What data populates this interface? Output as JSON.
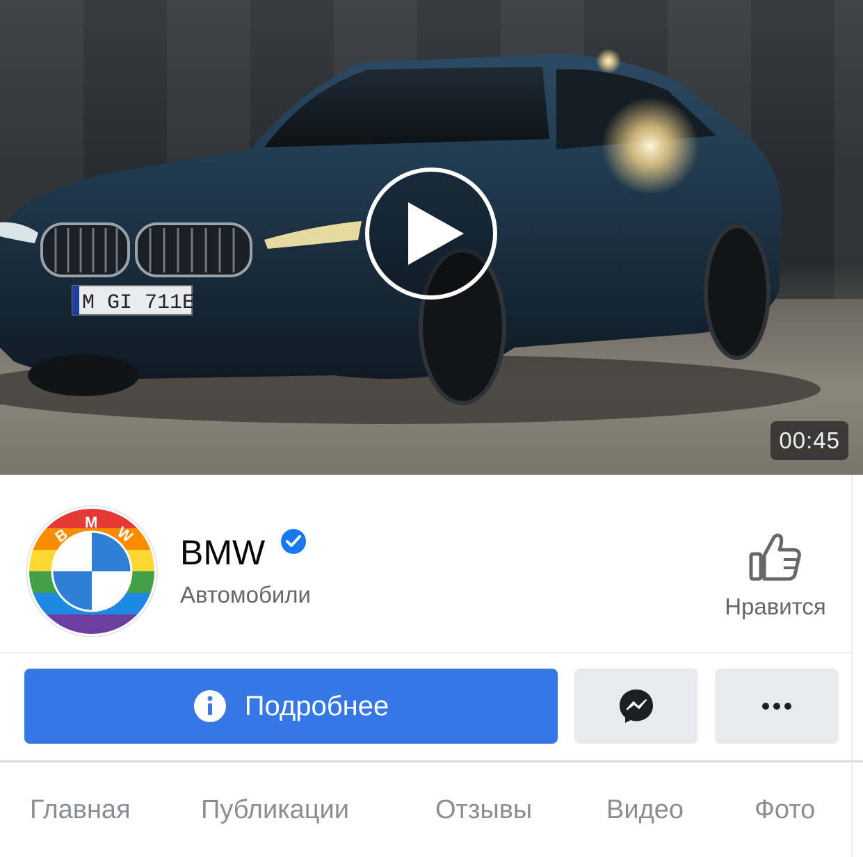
{
  "video": {
    "duration": "00:45",
    "plate": "M GI 711E"
  },
  "page": {
    "name": "BMW",
    "category": "Автомобили",
    "avatar_letters": [
      "B",
      "M",
      "W"
    ]
  },
  "actions": {
    "like_label": "Нравится",
    "more_info_label": "Подробнее"
  },
  "tabs": [
    {
      "label": "Главная"
    },
    {
      "label": "Публикации"
    },
    {
      "label": "Отзывы"
    },
    {
      "label": "Видео"
    },
    {
      "label": "Фото"
    }
  ],
  "colors": {
    "primary": "#3578e5",
    "verified": "#1877f2",
    "secondary_text": "#65676b",
    "tab_text": "#8a8d91"
  },
  "icons": {
    "play": "play-icon",
    "verified": "verified-badge-icon",
    "like": "thumbs-up-icon",
    "info": "info-icon",
    "messenger": "messenger-icon",
    "more": "more-dots-icon"
  }
}
